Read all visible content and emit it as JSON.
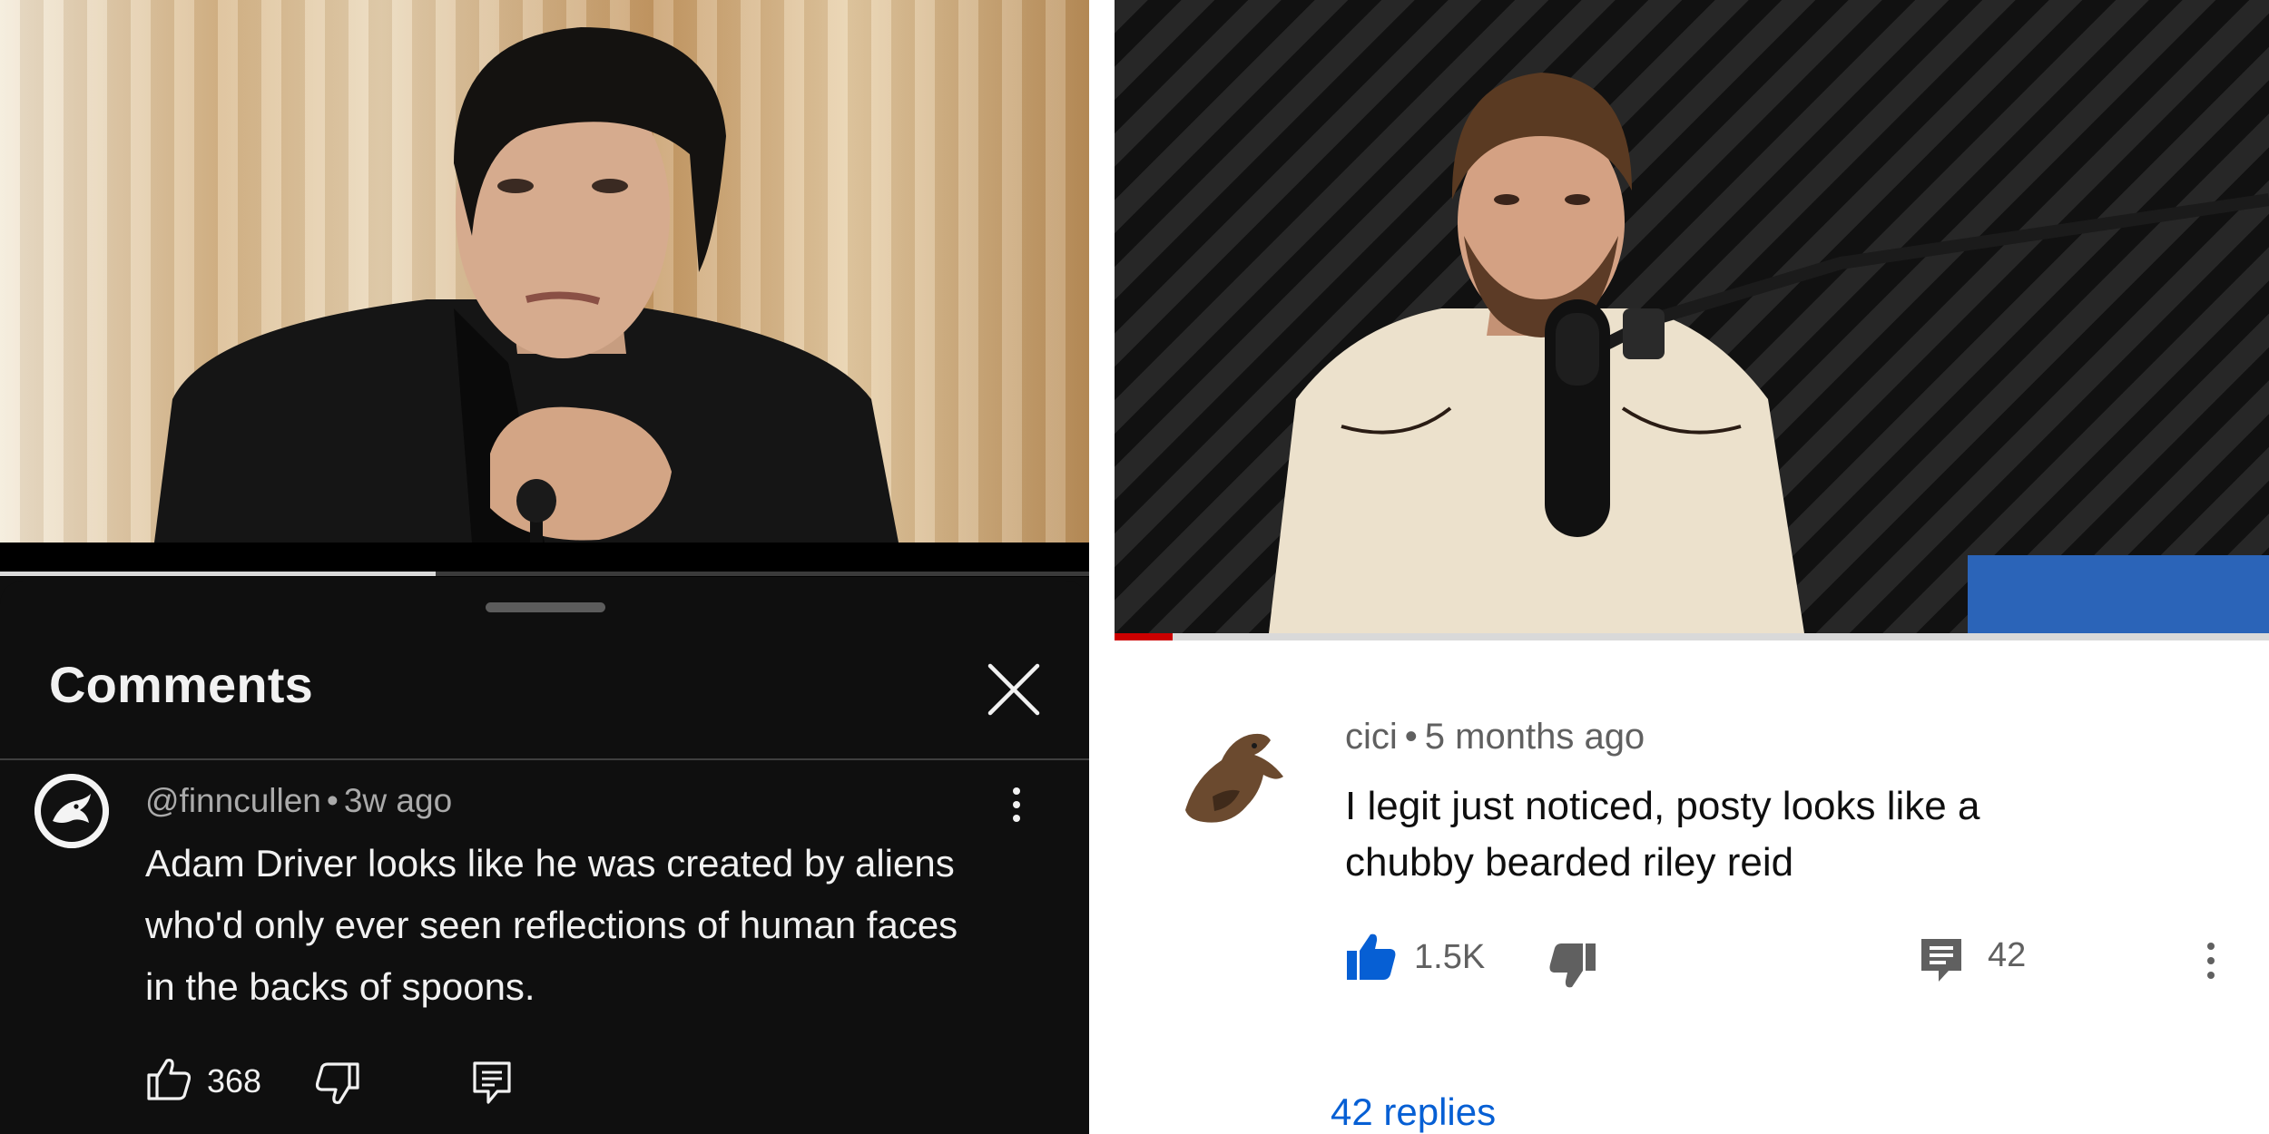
{
  "left_panel": {
    "theme_colors": {
      "background": "#0f0f0f",
      "text": "#f1f1f1",
      "secondary_text": "#aaaaaa"
    },
    "video": {
      "progress_fraction": 0.4
    },
    "sheet": {
      "title": "Comments"
    },
    "comment": {
      "handle": "@finncullen",
      "separator": "•",
      "time": "3w ago",
      "text": "Adam Driver looks like he was created by aliens who'd only ever seen reflections of human faces in the backs of spoons.",
      "like_count": "368"
    },
    "icons": {
      "close": "close-icon",
      "more": "more-vertical-icon",
      "like": "thumbs-up-outline-icon",
      "dislike": "thumbs-down-outline-icon",
      "reply": "comment-reply-icon"
    }
  },
  "right_panel": {
    "theme_colors": {
      "background": "#ffffff",
      "text": "#0f0f0f",
      "secondary_text": "#606060",
      "accent": "#065fd4",
      "progress": "#cc0000"
    },
    "video": {
      "progress_fraction": 0.05
    },
    "comment": {
      "author": "cici",
      "separator": "•",
      "time": "5 months ago",
      "text": "I legit just noticed, posty looks like a chubby bearded riley reid",
      "like_count": "1.5K",
      "reply_count": "42",
      "replies_link": "42 replies"
    },
    "icons": {
      "like": "thumbs-up-filled-icon",
      "dislike": "thumbs-down-filled-icon",
      "reply": "comment-reply-icon",
      "more": "more-vertical-icon"
    }
  }
}
